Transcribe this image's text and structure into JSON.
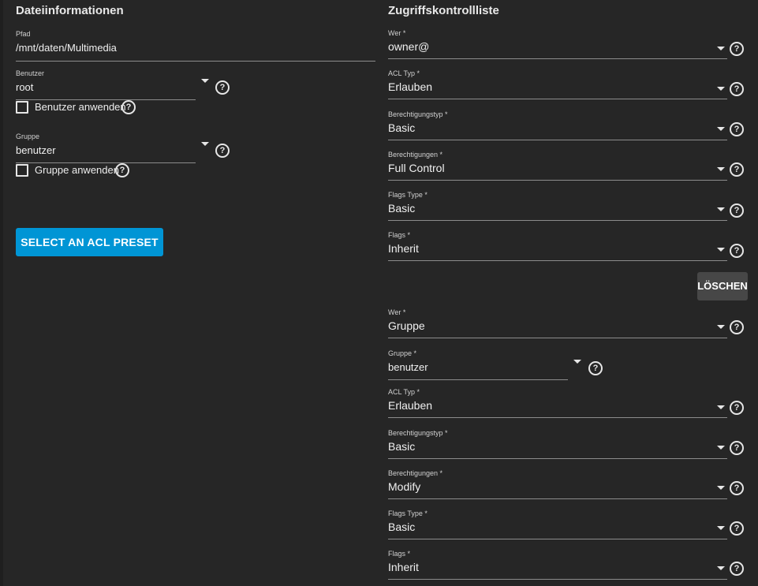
{
  "file_info": {
    "title": "Dateiinformationen",
    "path": {
      "label": "Pfad",
      "value": "/mnt/daten/Multimedia"
    },
    "user": {
      "label": "Benutzer",
      "value": "root",
      "apply_label": "Benutzer anwenden"
    },
    "group": {
      "label": "Gruppe",
      "value": "benutzer",
      "apply_label": "Gruppe anwenden"
    },
    "preset_button": "SELECT AN ACL PRESET"
  },
  "acl": {
    "title": "Zugriffskontrollliste",
    "delete_button": "LÖSCHEN",
    "entries": [
      {
        "who": {
          "label": "Wer *",
          "value": "owner@"
        },
        "acl_type": {
          "label": "ACL Typ *",
          "value": "Erlauben"
        },
        "perm_type": {
          "label": "Berechtigungstyp *",
          "value": "Basic"
        },
        "perms": {
          "label": "Berechtigungen *",
          "value": "Full Control"
        },
        "flags_type": {
          "label": "Flags Type *",
          "value": "Basic"
        },
        "flags": {
          "label": "Flags *",
          "value": "Inherit"
        }
      },
      {
        "who": {
          "label": "Wer *",
          "value": "Gruppe"
        },
        "group": {
          "label": "Gruppe *",
          "value": "benutzer"
        },
        "acl_type": {
          "label": "ACL Typ *",
          "value": "Erlauben"
        },
        "perm_type": {
          "label": "Berechtigungstyp *",
          "value": "Basic"
        },
        "perms": {
          "label": "Berechtigungen *",
          "value": "Modify"
        },
        "flags_type": {
          "label": "Flags Type *",
          "value": "Basic"
        },
        "flags": {
          "label": "Flags *",
          "value": "Inherit"
        }
      }
    ]
  },
  "icons": {
    "help": "help-circle-icon",
    "dropdown": "caret-down-icon",
    "checkbox": "checkbox-unchecked"
  },
  "colors": {
    "background": "#262626",
    "primary": "#0095d5",
    "secondary_button": "#474747"
  }
}
